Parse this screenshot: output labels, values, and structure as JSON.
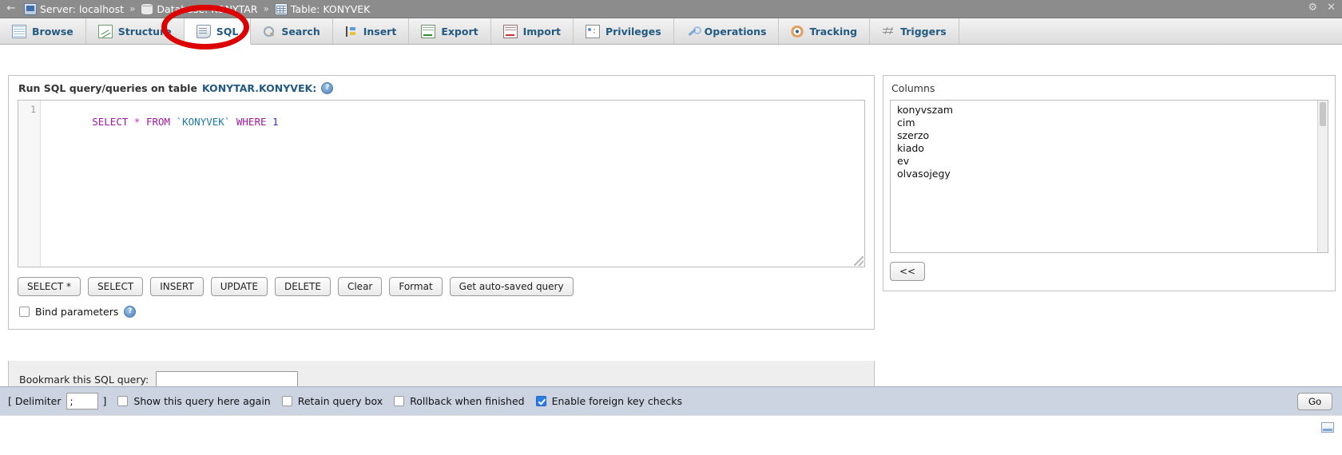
{
  "titlebar": {
    "back_arrow": "←",
    "breadcrumbs": [
      {
        "icon": "server-icon",
        "label": "Server: localhost"
      },
      {
        "icon": "database-icon",
        "label": "Database: KONYTAR"
      },
      {
        "icon": "table-icon",
        "label": "Table: KONYVEK"
      }
    ],
    "separator": "»",
    "gear_icon": "⚙",
    "close_icon": "✕"
  },
  "tabs": [
    {
      "label": "Browse",
      "icon": "browse-icon",
      "active": false
    },
    {
      "label": "Structure",
      "icon": "structure-icon",
      "active": false
    },
    {
      "label": "SQL",
      "icon": "sql-icon",
      "active": true
    },
    {
      "label": "Search",
      "icon": "search-icon",
      "active": false
    },
    {
      "label": "Insert",
      "icon": "insert-icon",
      "active": false
    },
    {
      "label": "Export",
      "icon": "export-icon",
      "active": false
    },
    {
      "label": "Import",
      "icon": "import-icon",
      "active": false
    },
    {
      "label": "Privileges",
      "icon": "privileges-icon",
      "active": false
    },
    {
      "label": "Operations",
      "icon": "operations-icon",
      "active": false
    },
    {
      "label": "Tracking",
      "icon": "tracking-icon",
      "active": false
    },
    {
      "label": "Triggers",
      "icon": "triggers-icon",
      "active": false
    }
  ],
  "annotation": {
    "shape": "circle",
    "color": "#dd0000",
    "target": "SQL tab"
  },
  "sql_panel": {
    "header_prefix": "Run SQL query/queries on table",
    "header_table": "KONYTAR.KONYVEK:",
    "help_icon": "?",
    "line_number": "1",
    "query_tokens": [
      {
        "text": "SELECT",
        "type": "keyword"
      },
      {
        "text": " ",
        "type": "plain"
      },
      {
        "text": "*",
        "type": "star"
      },
      {
        "text": " ",
        "type": "plain"
      },
      {
        "text": "FROM",
        "type": "keyword"
      },
      {
        "text": " ",
        "type": "plain"
      },
      {
        "text": "`KONYVEK`",
        "type": "table"
      },
      {
        "text": " ",
        "type": "plain"
      },
      {
        "text": "WHERE",
        "type": "keyword"
      },
      {
        "text": " ",
        "type": "plain"
      },
      {
        "text": "1",
        "type": "number"
      }
    ],
    "query_text": "SELECT * FROM `KONYVEK` WHERE 1",
    "buttons": [
      "SELECT *",
      "SELECT",
      "INSERT",
      "UPDATE",
      "DELETE",
      "Clear",
      "Format",
      "Get auto-saved query"
    ],
    "bind_parameters": {
      "label": "Bind parameters",
      "checked": false,
      "help_icon": "?"
    }
  },
  "bookmark": {
    "label": "Bookmark this SQL query:",
    "value": "",
    "placeholder": ""
  },
  "columns_panel": {
    "title": "Columns",
    "items": [
      "konyvszam",
      "cim",
      "szerzo",
      "kiado",
      "ev",
      "olvasojegy"
    ],
    "insert_button": "<<"
  },
  "bottom_bar": {
    "delimiter_open": "[ Delimiter",
    "delimiter_value": ";",
    "delimiter_close": "]",
    "checkboxes": [
      {
        "label": "Show this query here again",
        "checked": false
      },
      {
        "label": "Retain query box",
        "checked": false
      },
      {
        "label": "Rollback when finished",
        "checked": false
      },
      {
        "label": "Enable foreign key checks",
        "checked": true
      }
    ],
    "go_button": "Go"
  },
  "colors": {
    "accent": "#235a81",
    "annotation": "#dd0000",
    "checkbox_checked": "#2a7ee8",
    "bottom_bar": "#ccd4e2",
    "titlebar": "#8c8c8c"
  }
}
